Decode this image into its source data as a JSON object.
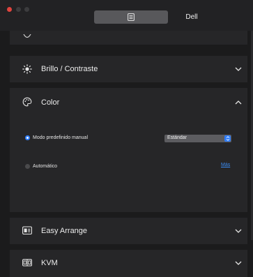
{
  "window": {
    "title": "Dell"
  },
  "titlebar": {
    "tab_icon": "document-icon"
  },
  "sections": [
    {
      "label": "Brillo / Contraste",
      "icon": "brightness-icon",
      "expanded": false
    },
    {
      "label": "Color",
      "icon": "palette-icon",
      "expanded": true
    },
    {
      "label": "Easy Arrange",
      "icon": "layout-icon",
      "expanded": false
    },
    {
      "label": "KVM",
      "icon": "kvm-icon",
      "expanded": false
    }
  ],
  "color_panel": {
    "preset_option": {
      "label": "Modo predefinido manual",
      "selected": true
    },
    "preset_select": {
      "value": "Estándar"
    },
    "auto_option": {
      "label": "Automático",
      "selected": false
    },
    "more_link": "Más"
  },
  "colors": {
    "accent": "#2f7cf6",
    "panel": "#262628",
    "background": "#1b1b1c",
    "close": "#e0443e"
  }
}
